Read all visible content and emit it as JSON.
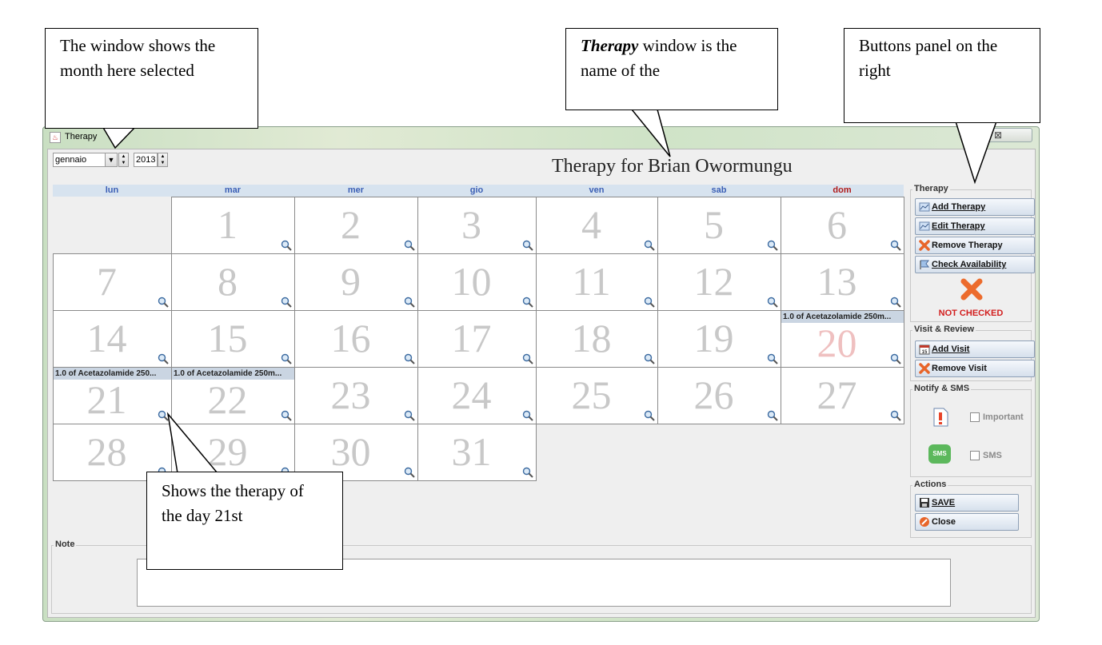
{
  "window": {
    "title": "Therapy",
    "close_glyph": "⊠"
  },
  "selectors": {
    "month": "gennaio",
    "year": "2013"
  },
  "heading": "Therapy for Brian Owormungu",
  "weekdays": [
    "lun",
    "mar",
    "mer",
    "gio",
    "ven",
    "sab",
    "dom"
  ],
  "days": [
    {
      "day": "1",
      "event": ""
    },
    {
      "day": "2",
      "event": ""
    },
    {
      "day": "3",
      "event": ""
    },
    {
      "day": "4",
      "event": ""
    },
    {
      "day": "5",
      "event": ""
    },
    {
      "day": "6",
      "event": ""
    },
    {
      "day": "7",
      "event": ""
    },
    {
      "day": "8",
      "event": ""
    },
    {
      "day": "9",
      "event": ""
    },
    {
      "day": "10",
      "event": ""
    },
    {
      "day": "11",
      "event": ""
    },
    {
      "day": "12",
      "event": ""
    },
    {
      "day": "13",
      "event": ""
    },
    {
      "day": "14",
      "event": ""
    },
    {
      "day": "15",
      "event": ""
    },
    {
      "day": "16",
      "event": ""
    },
    {
      "day": "17",
      "event": ""
    },
    {
      "day": "18",
      "event": ""
    },
    {
      "day": "19",
      "event": ""
    },
    {
      "day": "20",
      "event": "1.0 of Acetazolamide 250m..."
    },
    {
      "day": "21",
      "event": "1.0 of Acetazolamide 250..."
    },
    {
      "day": "22",
      "event": "1.0 of Acetazolamide 250m..."
    },
    {
      "day": "23",
      "event": ""
    },
    {
      "day": "24",
      "event": ""
    },
    {
      "day": "25",
      "event": ""
    },
    {
      "day": "26",
      "event": ""
    },
    {
      "day": "27",
      "event": ""
    },
    {
      "day": "28",
      "event": ""
    },
    {
      "day": "29",
      "event": ""
    },
    {
      "day": "30",
      "event": ""
    },
    {
      "day": "31",
      "event": ""
    }
  ],
  "panel": {
    "therapy_group": "Therapy",
    "add_therapy": "Add Therapy",
    "edit_therapy": "Edit Therapy",
    "remove_therapy": "Remove Therapy",
    "check_availability": "Check Availability",
    "status": "NOT CHECKED",
    "visit_group": "Visit & Review",
    "add_visit": "Add Visit",
    "remove_visit": "Remove Visit",
    "notify_group": "Notify & SMS",
    "important_label": "Important",
    "sms_label": "SMS",
    "sms_icon_text": "SMS",
    "actions_group": "Actions",
    "save": "SAVE",
    "close": "Close"
  },
  "note": {
    "label": "Note",
    "value": ""
  },
  "callouts": {
    "month": "The window shows the month here selected",
    "title_part1": "Therapy",
    "title_part2": " window is the name of the",
    "buttons": "Buttons panel on the right",
    "day": "Shows the therapy of the day 21st"
  },
  "colors": {
    "weekday": "#3b5fb5",
    "sunday": "#b01c1c",
    "status": "#d21d1d",
    "event_bg": "#cad5e2"
  }
}
